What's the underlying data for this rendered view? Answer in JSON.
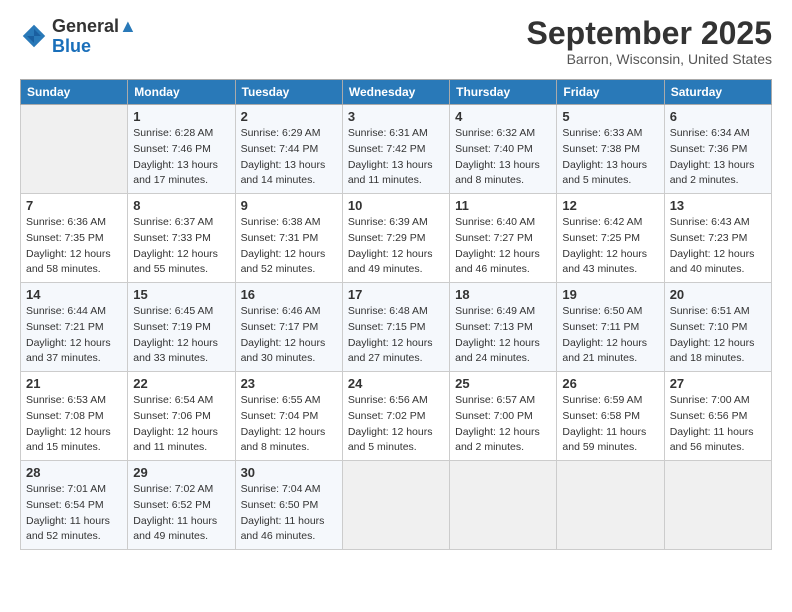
{
  "logo": {
    "text_general": "General",
    "text_blue": "Blue"
  },
  "title": "September 2025",
  "location": "Barron, Wisconsin, United States",
  "days_of_week": [
    "Sunday",
    "Monday",
    "Tuesday",
    "Wednesday",
    "Thursday",
    "Friday",
    "Saturday"
  ],
  "weeks": [
    [
      {
        "day": "",
        "sunrise": "",
        "sunset": "",
        "daylight": ""
      },
      {
        "day": "1",
        "sunrise": "Sunrise: 6:28 AM",
        "sunset": "Sunset: 7:46 PM",
        "daylight": "Daylight: 13 hours and 17 minutes."
      },
      {
        "day": "2",
        "sunrise": "Sunrise: 6:29 AM",
        "sunset": "Sunset: 7:44 PM",
        "daylight": "Daylight: 13 hours and 14 minutes."
      },
      {
        "day": "3",
        "sunrise": "Sunrise: 6:31 AM",
        "sunset": "Sunset: 7:42 PM",
        "daylight": "Daylight: 13 hours and 11 minutes."
      },
      {
        "day": "4",
        "sunrise": "Sunrise: 6:32 AM",
        "sunset": "Sunset: 7:40 PM",
        "daylight": "Daylight: 13 hours and 8 minutes."
      },
      {
        "day": "5",
        "sunrise": "Sunrise: 6:33 AM",
        "sunset": "Sunset: 7:38 PM",
        "daylight": "Daylight: 13 hours and 5 minutes."
      },
      {
        "day": "6",
        "sunrise": "Sunrise: 6:34 AM",
        "sunset": "Sunset: 7:36 PM",
        "daylight": "Daylight: 13 hours and 2 minutes."
      }
    ],
    [
      {
        "day": "7",
        "sunrise": "Sunrise: 6:36 AM",
        "sunset": "Sunset: 7:35 PM",
        "daylight": "Daylight: 12 hours and 58 minutes."
      },
      {
        "day": "8",
        "sunrise": "Sunrise: 6:37 AM",
        "sunset": "Sunset: 7:33 PM",
        "daylight": "Daylight: 12 hours and 55 minutes."
      },
      {
        "day": "9",
        "sunrise": "Sunrise: 6:38 AM",
        "sunset": "Sunset: 7:31 PM",
        "daylight": "Daylight: 12 hours and 52 minutes."
      },
      {
        "day": "10",
        "sunrise": "Sunrise: 6:39 AM",
        "sunset": "Sunset: 7:29 PM",
        "daylight": "Daylight: 12 hours and 49 minutes."
      },
      {
        "day": "11",
        "sunrise": "Sunrise: 6:40 AM",
        "sunset": "Sunset: 7:27 PM",
        "daylight": "Daylight: 12 hours and 46 minutes."
      },
      {
        "day": "12",
        "sunrise": "Sunrise: 6:42 AM",
        "sunset": "Sunset: 7:25 PM",
        "daylight": "Daylight: 12 hours and 43 minutes."
      },
      {
        "day": "13",
        "sunrise": "Sunrise: 6:43 AM",
        "sunset": "Sunset: 7:23 PM",
        "daylight": "Daylight: 12 hours and 40 minutes."
      }
    ],
    [
      {
        "day": "14",
        "sunrise": "Sunrise: 6:44 AM",
        "sunset": "Sunset: 7:21 PM",
        "daylight": "Daylight: 12 hours and 37 minutes."
      },
      {
        "day": "15",
        "sunrise": "Sunrise: 6:45 AM",
        "sunset": "Sunset: 7:19 PM",
        "daylight": "Daylight: 12 hours and 33 minutes."
      },
      {
        "day": "16",
        "sunrise": "Sunrise: 6:46 AM",
        "sunset": "Sunset: 7:17 PM",
        "daylight": "Daylight: 12 hours and 30 minutes."
      },
      {
        "day": "17",
        "sunrise": "Sunrise: 6:48 AM",
        "sunset": "Sunset: 7:15 PM",
        "daylight": "Daylight: 12 hours and 27 minutes."
      },
      {
        "day": "18",
        "sunrise": "Sunrise: 6:49 AM",
        "sunset": "Sunset: 7:13 PM",
        "daylight": "Daylight: 12 hours and 24 minutes."
      },
      {
        "day": "19",
        "sunrise": "Sunrise: 6:50 AM",
        "sunset": "Sunset: 7:11 PM",
        "daylight": "Daylight: 12 hours and 21 minutes."
      },
      {
        "day": "20",
        "sunrise": "Sunrise: 6:51 AM",
        "sunset": "Sunset: 7:10 PM",
        "daylight": "Daylight: 12 hours and 18 minutes."
      }
    ],
    [
      {
        "day": "21",
        "sunrise": "Sunrise: 6:53 AM",
        "sunset": "Sunset: 7:08 PM",
        "daylight": "Daylight: 12 hours and 15 minutes."
      },
      {
        "day": "22",
        "sunrise": "Sunrise: 6:54 AM",
        "sunset": "Sunset: 7:06 PM",
        "daylight": "Daylight: 12 hours and 11 minutes."
      },
      {
        "day": "23",
        "sunrise": "Sunrise: 6:55 AM",
        "sunset": "Sunset: 7:04 PM",
        "daylight": "Daylight: 12 hours and 8 minutes."
      },
      {
        "day": "24",
        "sunrise": "Sunrise: 6:56 AM",
        "sunset": "Sunset: 7:02 PM",
        "daylight": "Daylight: 12 hours and 5 minutes."
      },
      {
        "day": "25",
        "sunrise": "Sunrise: 6:57 AM",
        "sunset": "Sunset: 7:00 PM",
        "daylight": "Daylight: 12 hours and 2 minutes."
      },
      {
        "day": "26",
        "sunrise": "Sunrise: 6:59 AM",
        "sunset": "Sunset: 6:58 PM",
        "daylight": "Daylight: 11 hours and 59 minutes."
      },
      {
        "day": "27",
        "sunrise": "Sunrise: 7:00 AM",
        "sunset": "Sunset: 6:56 PM",
        "daylight": "Daylight: 11 hours and 56 minutes."
      }
    ],
    [
      {
        "day": "28",
        "sunrise": "Sunrise: 7:01 AM",
        "sunset": "Sunset: 6:54 PM",
        "daylight": "Daylight: 11 hours and 52 minutes."
      },
      {
        "day": "29",
        "sunrise": "Sunrise: 7:02 AM",
        "sunset": "Sunset: 6:52 PM",
        "daylight": "Daylight: 11 hours and 49 minutes."
      },
      {
        "day": "30",
        "sunrise": "Sunrise: 7:04 AM",
        "sunset": "Sunset: 6:50 PM",
        "daylight": "Daylight: 11 hours and 46 minutes."
      },
      {
        "day": "",
        "sunrise": "",
        "sunset": "",
        "daylight": ""
      },
      {
        "day": "",
        "sunrise": "",
        "sunset": "",
        "daylight": ""
      },
      {
        "day": "",
        "sunrise": "",
        "sunset": "",
        "daylight": ""
      },
      {
        "day": "",
        "sunrise": "",
        "sunset": "",
        "daylight": ""
      }
    ]
  ]
}
